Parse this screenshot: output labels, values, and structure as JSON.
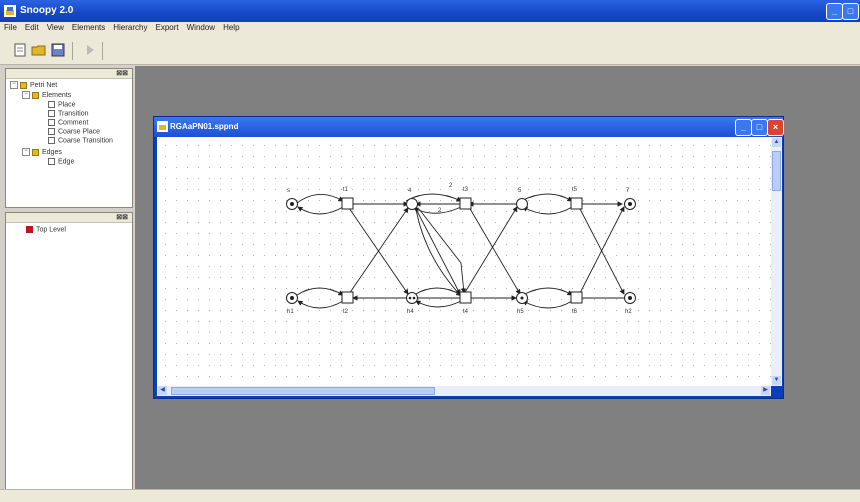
{
  "window": {
    "title": "Snoopy 2.0"
  },
  "menu": [
    "File",
    "Edit",
    "View",
    "Elements",
    "Hierarchy",
    "Export",
    "Window",
    "Help"
  ],
  "toolbar": {
    "buttons": [
      "new-icon",
      "open-icon",
      "save-icon",
      "run-icon"
    ]
  },
  "tree_panel": {
    "root": "Petri Net",
    "elements_folder": "Elements",
    "elements": [
      "Place",
      "Transition",
      "Comment",
      "Coarse Place",
      "Coarse Transition"
    ],
    "edges_folder": "Edges",
    "edges": [
      "Edge"
    ]
  },
  "hierarchy_panel": {
    "items": [
      "Top Level"
    ]
  },
  "document": {
    "title": "RGAaPN01.sppnd",
    "places": [
      {
        "label": "s"
      },
      {
        "label": "4"
      },
      {
        "label": "5"
      },
      {
        "label": "7"
      },
      {
        "label": "h1"
      },
      {
        "label": "h4"
      },
      {
        "label": "h5"
      },
      {
        "label": "h2"
      }
    ],
    "transitions": [
      {
        "label": "t1"
      },
      {
        "label": "t3"
      },
      {
        "label": "t5"
      },
      {
        "label": "t2"
      },
      {
        "label": "t4"
      },
      {
        "label": "t6"
      }
    ],
    "arc_labels": [
      "2",
      "2"
    ]
  }
}
